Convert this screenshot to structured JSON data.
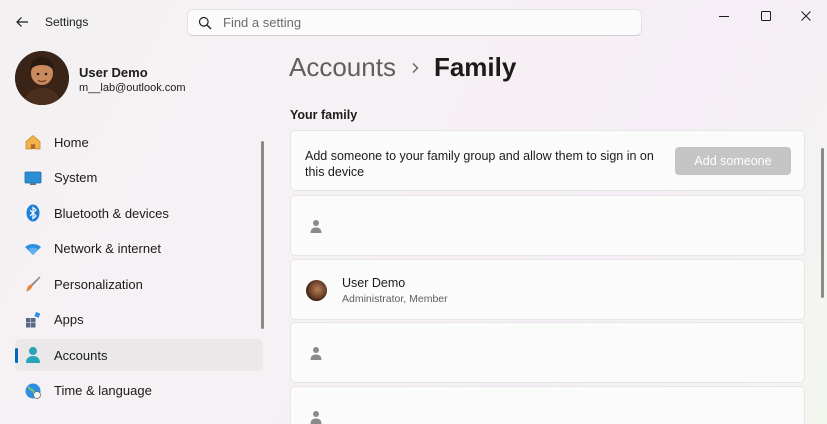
{
  "window": {
    "title": "Settings",
    "controls": [
      "minimize-icon",
      "maximize-icon",
      "close-icon"
    ]
  },
  "search": {
    "placeholder": "Find a setting",
    "value": ""
  },
  "profile": {
    "name": "User Demo",
    "email": "m__lab@outlook.com"
  },
  "sidebar": {
    "items": [
      {
        "label": "Home",
        "icon": "home-icon",
        "active": false
      },
      {
        "label": "System",
        "icon": "system-icon",
        "active": false
      },
      {
        "label": "Bluetooth & devices",
        "icon": "bluetooth-icon",
        "active": false
      },
      {
        "label": "Network & internet",
        "icon": "network-icon",
        "active": false
      },
      {
        "label": "Personalization",
        "icon": "brush-icon",
        "active": false
      },
      {
        "label": "Apps",
        "icon": "apps-icon",
        "active": false
      },
      {
        "label": "Accounts",
        "icon": "accounts-icon",
        "active": true
      },
      {
        "label": "Time & language",
        "icon": "globe-icon",
        "active": false
      }
    ]
  },
  "breadcrumb": {
    "parent": "Accounts",
    "current": "Family"
  },
  "family": {
    "section_title": "Your family",
    "add_text": "Add someone to your family group and allow them to sign in on this device",
    "add_button": "Add someone",
    "members": [
      {
        "name": "",
        "role": ""
      },
      {
        "name": "User Demo",
        "role": "Administrator, Member"
      },
      {
        "name": "",
        "role": ""
      }
    ]
  },
  "colors": {
    "accent": "#0067c0",
    "disabled_button": "#c5c5c5"
  }
}
